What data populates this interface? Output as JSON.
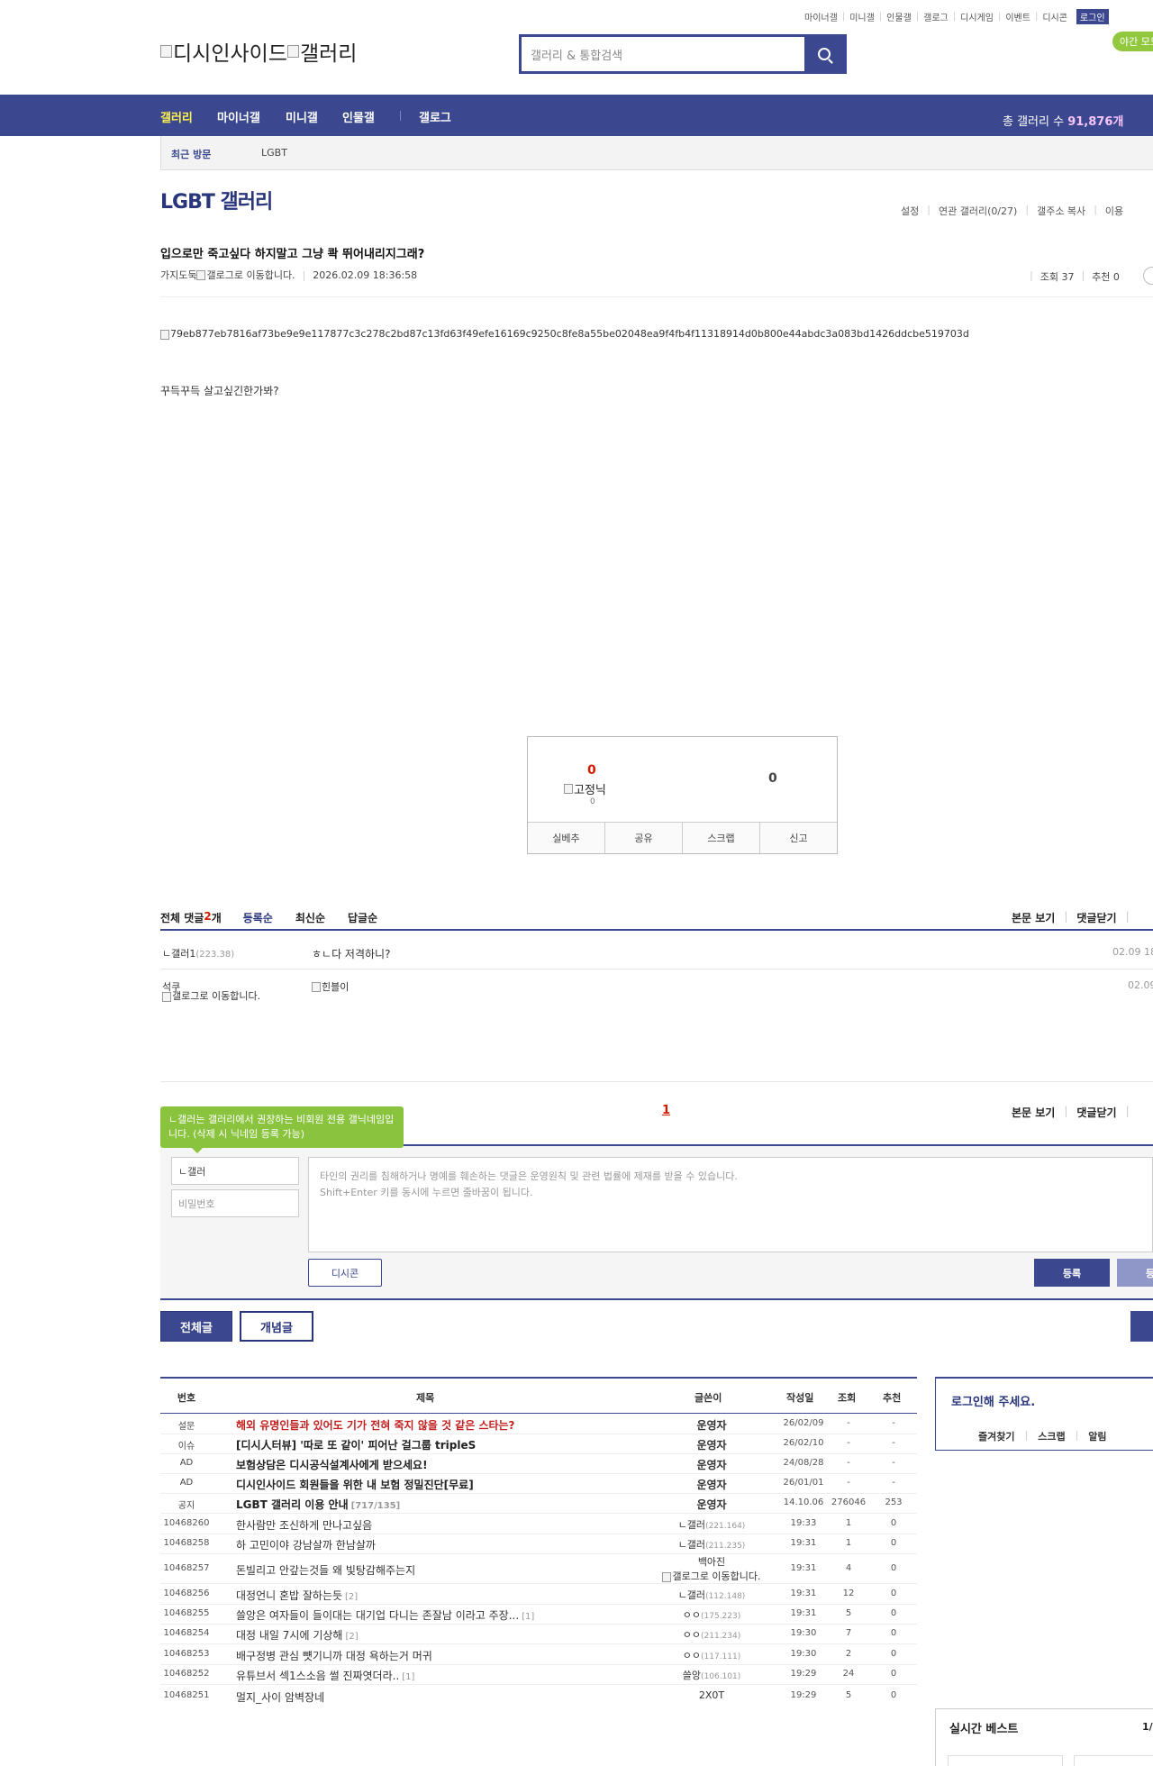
{
  "header": {
    "util_links": [
      "마이너갤",
      "미니갤",
      "인물갤",
      "갤로그",
      "디시게임",
      "이벤트",
      "디시콘"
    ],
    "login_label": "로그인",
    "night_mode_label": "야간 모드",
    "logo_part1": "디시인사이드",
    "logo_part2": "갤러리",
    "search_placeholder": "갤러리 & 통합검색"
  },
  "gnb": {
    "items": [
      "갤러리",
      "마이너갤",
      "미니갤",
      "인물갤",
      "갤로그"
    ],
    "total_label": "총 갤러리 수 ",
    "total_value": "91,876개"
  },
  "visit": {
    "label": "최근 방문",
    "items": [
      "LGBT"
    ]
  },
  "gallery": {
    "title": "LGBT 갤러리",
    "links": [
      "설정",
      "연관 갤러리(0/27)",
      "갤주소 복사",
      "이용"
    ]
  },
  "post": {
    "title": "입으로만 죽고싶다 하지말고 그냥 콱 뛰어내리지그래?",
    "author": "가지도둑",
    "author_icon_alt": "갤로그로 이동합니다.",
    "date": "2026.02.09 18:36:58",
    "views": "조회 37",
    "recommends": "추천 0",
    "image_name": "79eb877eb7816af73be9e9e117877c3c278c2bd87c13fd63f49efe16169c9250c8fe8a55be02048ea9f4fb4f11318914d0b800e44abdc3a083bd1426ddcbe519703d",
    "body": "꾸득꾸득 살고싶긴한가봐?"
  },
  "recommend_box": {
    "up_count": "0",
    "down_count": "0",
    "fixed_nick_alt": "고정닉",
    "fixed_nick_count": "0",
    "buttons": [
      "실베추",
      "공유",
      "스크랩",
      "신고"
    ]
  },
  "comments": {
    "head_label": "전체 댓글 ",
    "count": "2",
    "count_unit": "개",
    "sort_options": [
      "등록순",
      "최신순",
      "답글순"
    ],
    "right_links": [
      "본문 보기",
      "댓글닫기"
    ],
    "items": [
      {
        "name": "ㄴ갤러1",
        "ip": "(223.38)",
        "text": "ㅎㄴ다 저격하니?",
        "date": "02.09 18"
      },
      {
        "name": "석쿠",
        "icon_alt": "갤로그로 이동합니다.",
        "text_img_alt": "힌블이",
        "date": "02.09"
      }
    ],
    "pager_current": "1"
  },
  "write": {
    "tooltip": "ㄴ갤러는 갤러리에서 권장하는 비회원 전용 갤닉네임입니다. (삭제 시 닉네임 등록 가능)",
    "nickname_value": "ㄴ갤러",
    "password_placeholder": "비밀번호",
    "textarea_line1": "타인의 권리를 침해하거나 명예를 훼손하는 댓글은 운영원칙 및 관련 법률에 제재를 받을 수 있습니다.",
    "textarea_line2": "Shift+Enter 키를 동시에 누르면 줄바꿈이 됩니다.",
    "dccon_label": "디시콘",
    "submit_label": "등록",
    "submit2_label": "등록"
  },
  "tabs": {
    "all": "전체글",
    "best": "개념글"
  },
  "list": {
    "headers": [
      "번호",
      "제목",
      "글쓴이",
      "작성일",
      "조회",
      "추천"
    ],
    "rows": [
      {
        "num": "설문",
        "title": "해외 유명인들과 있어도 기가 전혀 죽지 않을 것 같은 스타는?",
        "style": "red",
        "writer": "운영자",
        "writer_bold": true,
        "date": "26/02/09",
        "views": "-",
        "rec": "-"
      },
      {
        "num": "이슈",
        "title": "[디시人터뷰] '따로 또 같이' 피어난 걸그룹 tripleS",
        "style": "bold",
        "writer": "운영자",
        "writer_bold": true,
        "date": "26/02/10",
        "views": "-",
        "rec": "-"
      },
      {
        "num": "AD",
        "title": "보험상담은 디시공식설계사에게 받으세요!",
        "style": "bold",
        "writer": "운영자",
        "writer_bold": true,
        "date": "24/08/28",
        "views": "-",
        "rec": "-"
      },
      {
        "num": "AD",
        "title": "디시인사이드 회원들을 위한 내 보험 정밀진단[무료]",
        "style": "bold",
        "writer": "운영자",
        "writer_bold": true,
        "date": "26/01/01",
        "views": "-",
        "rec": "-"
      },
      {
        "num": "공지",
        "title": "LGBT 갤러리 이용 안내",
        "cnt": "[717/135]",
        "style": "bold",
        "writer": "운영자",
        "writer_bold": true,
        "date": "14.10.06",
        "views": "276046",
        "rec": "253"
      },
      {
        "num": "10468260",
        "title": "한사람만 조신하게 만나고싶음",
        "writer": "ㄴ갤러",
        "ip": "(221.164)",
        "date": "19:33",
        "views": "1",
        "rec": "0"
      },
      {
        "num": "10468258",
        "title": "하 고민이야 강남살까 한남살까",
        "writer": "ㄴ갤러",
        "ip": "(211.235)",
        "date": "19:31",
        "views": "1",
        "rec": "0"
      },
      {
        "num": "10468257",
        "title": "돈빌리고 안갚는것들 왜 빛탕감해주는지",
        "writer": "백아진",
        "writer_icon_alt": "갤로그로 이동합니다.",
        "date": "19:31",
        "views": "4",
        "rec": "0"
      },
      {
        "num": "10468256",
        "title": "대정언니 혼밥 잘하는듯",
        "cnt": "[2]",
        "writer": "ㄴ갤러",
        "ip": "(112.148)",
        "date": "19:31",
        "views": "12",
        "rec": "0"
      },
      {
        "num": "10468255",
        "title": "쓸앙은 여자들이 들이대는 대기업 다니는 존잘남 이라고 주장...",
        "cnt": "[1]",
        "writer": "ㅇㅇ",
        "ip": "(175.223)",
        "date": "19:31",
        "views": "5",
        "rec": "0"
      },
      {
        "num": "10468254",
        "title": "대정 내일 7시에 기상해",
        "cnt": "[2]",
        "writer": "ㅇㅇ",
        "ip": "(211.234)",
        "date": "19:30",
        "views": "7",
        "rec": "0"
      },
      {
        "num": "10468253",
        "title": "배구정병 관심 뻇기니까 대정 욕하는거 머귀",
        "writer": "ㅇㅇ",
        "ip": "(117.111)",
        "date": "19:30",
        "views": "2",
        "rec": "0"
      },
      {
        "num": "10468252",
        "title": "유튜브서 섹1스소음 썰 진짜엿더라..",
        "cnt": "[1]",
        "writer": "쓸앙",
        "ip": "(106.101)",
        "date": "19:29",
        "views": "24",
        "rec": "0"
      },
      {
        "num": "10468251",
        "title": "멀지_사이 암벽장네",
        "writer": "2X0T",
        "date": "19:29",
        "views": "5",
        "rec": "0"
      }
    ]
  },
  "sidebar": {
    "login_title": "로그인해 주세요.",
    "login_links": [
      "즐겨찾기",
      "스크랩",
      "알림"
    ],
    "best_title": "실시간 베스트",
    "best_page": "1/"
  }
}
